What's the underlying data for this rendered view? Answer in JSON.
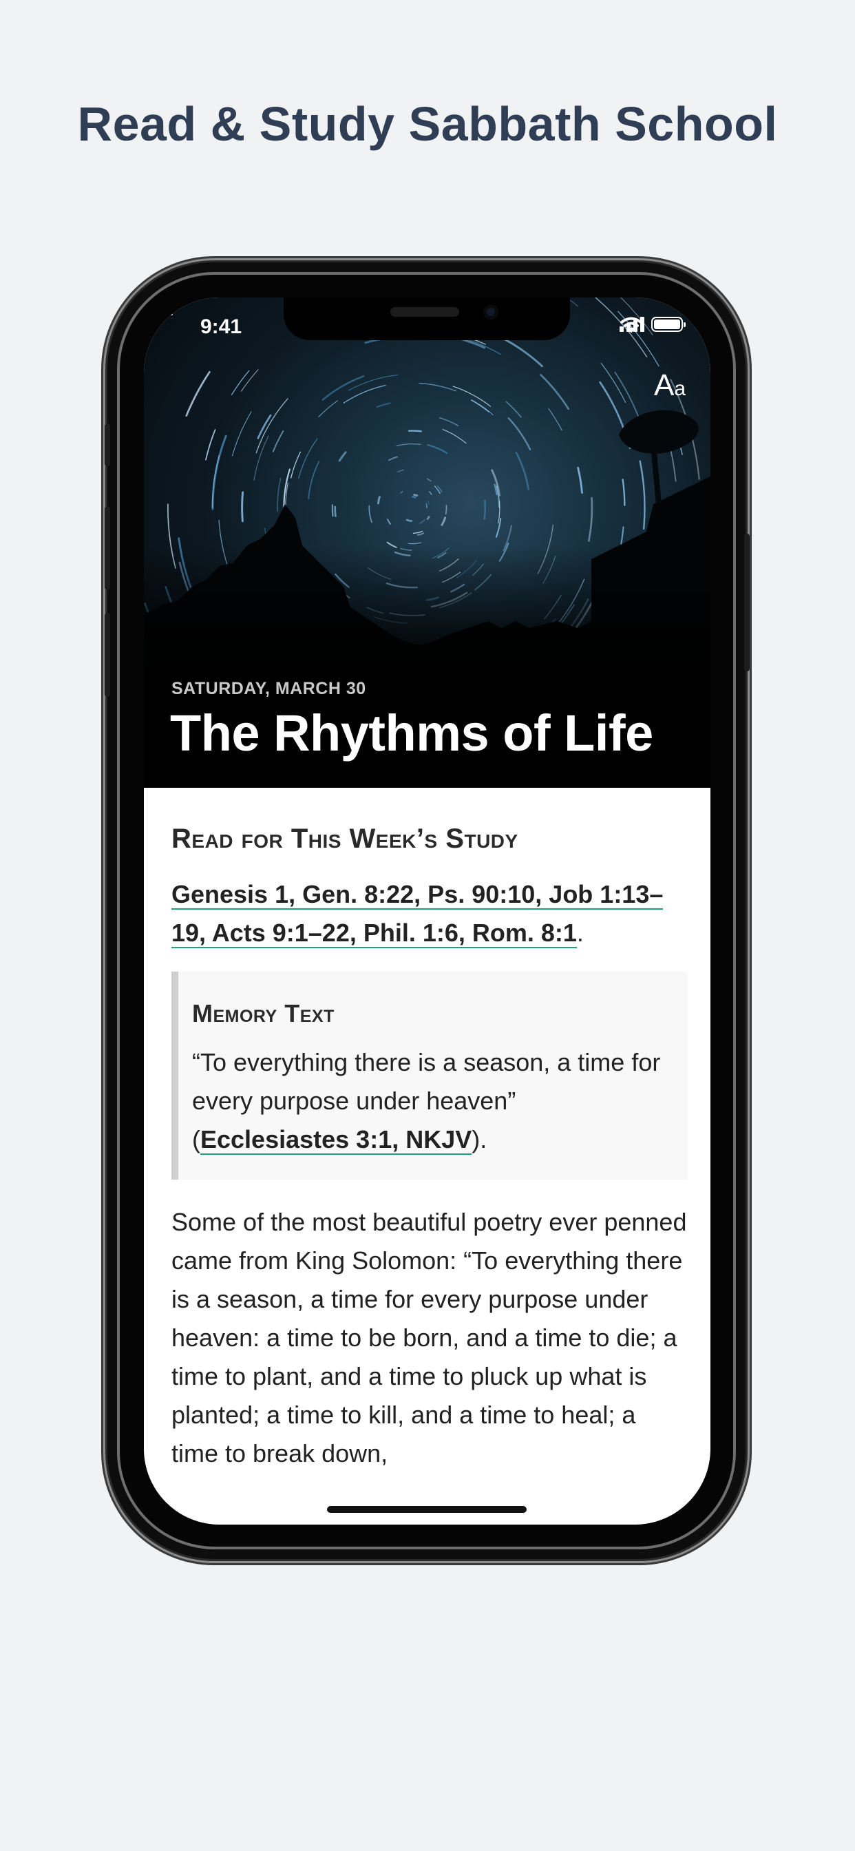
{
  "page": {
    "headline": "Read & Study Sabbath School"
  },
  "status_bar": {
    "time": "9:41",
    "icons": [
      "signal-icon",
      "wifi-icon",
      "battery-icon"
    ]
  },
  "toolbar": {
    "back_icon": "arrow-left-icon",
    "font_button_big": "A",
    "font_button_small": "a"
  },
  "lesson": {
    "date": "SATURDAY, MARCH 30",
    "title": "The Rhythms of Life"
  },
  "reading": {
    "heading": "Read for This Week’s Study",
    "refs_line1": "Genesis 1, Gen. 8:22, Ps. 90:10, Job 1:13–",
    "refs_line2": "19, Acts 9:1–22, Phil. 1:6, Rom. 8:1",
    "refs_end": "."
  },
  "memory": {
    "heading": "Memory Text",
    "quote": "“To everything there is a season, a time for every purpose under heaven”",
    "open_paren": "(",
    "reference": "Ecclesiastes 3:1, NKJV",
    "close": ")."
  },
  "body": {
    "paragraph": "Some of the most beautiful poetry ever penned came from King Solomon: “To everything there is a season, a time for every purpose under heaven: a time to be born, and a time to die; a time to plant, and a time to pluck up what is planted; a time to kill, and a time to heal; a time to break down,"
  },
  "colors": {
    "headline": "#2f3d55",
    "link_underline": "#1aa37a",
    "page_background": "#f1f2f4"
  }
}
